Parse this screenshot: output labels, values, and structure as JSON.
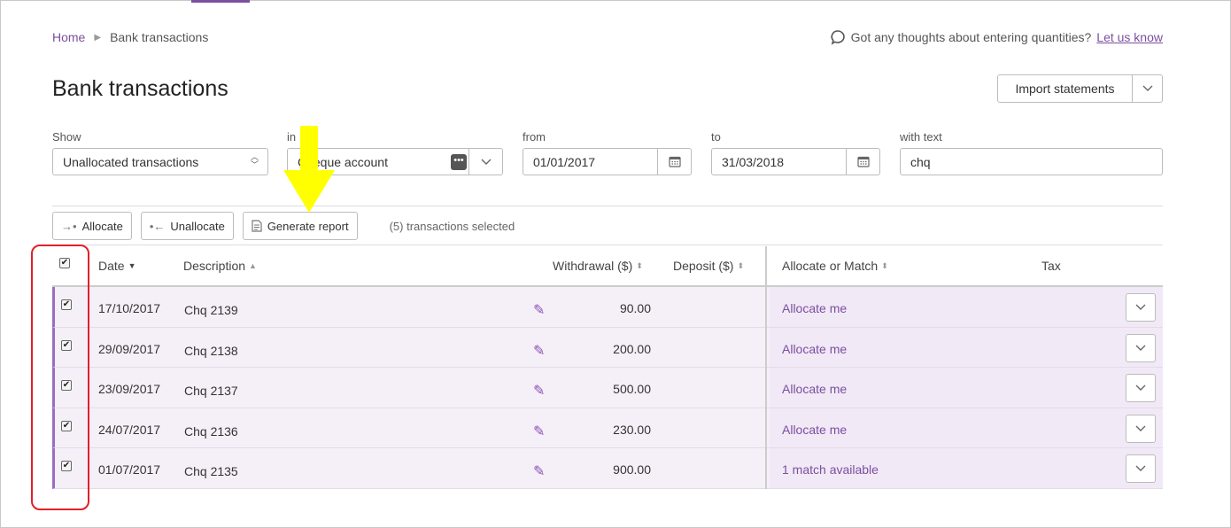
{
  "breadcrumb": {
    "home": "Home",
    "current": "Bank transactions"
  },
  "feedback": {
    "text": "Got any thoughts about entering quantities?",
    "link": "Let us know"
  },
  "page_title": "Bank transactions",
  "import_button": "Import statements",
  "filters": {
    "show_label": "Show",
    "show_value": "Unallocated transactions",
    "in_label": "in",
    "in_value": "Cheque account",
    "from_label": "from",
    "from_value": "01/01/2017",
    "to_label": "to",
    "to_value": "31/03/2018",
    "text_label": "with text",
    "text_value": "chq"
  },
  "actions": {
    "allocate": "Allocate",
    "unallocate": "Unallocate",
    "generate_report": "Generate report",
    "selected": "(5) transactions selected"
  },
  "columns": {
    "date": "Date",
    "description": "Description",
    "withdrawal": "Withdrawal ($)",
    "deposit": "Deposit ($)",
    "allocate": "Allocate or Match",
    "tax": "Tax"
  },
  "rows": [
    {
      "date": "17/10/2017",
      "description": "Chq 2139",
      "withdrawal": "90.00",
      "allocate": "Allocate me"
    },
    {
      "date": "29/09/2017",
      "description": "Chq 2138",
      "withdrawal": "200.00",
      "allocate": "Allocate me"
    },
    {
      "date": "23/09/2017",
      "description": "Chq 2137",
      "withdrawal": "500.00",
      "allocate": "Allocate me"
    },
    {
      "date": "24/07/2017",
      "description": "Chq 2136",
      "withdrawal": "230.00",
      "allocate": "Allocate me"
    },
    {
      "date": "01/07/2017",
      "description": "Chq 2135",
      "withdrawal": "900.00",
      "allocate": "1 match available"
    }
  ],
  "colors": {
    "accent": "#7b4fa0",
    "highlight_arrow": "#ffff00",
    "annotation_box": "#e0202a"
  }
}
